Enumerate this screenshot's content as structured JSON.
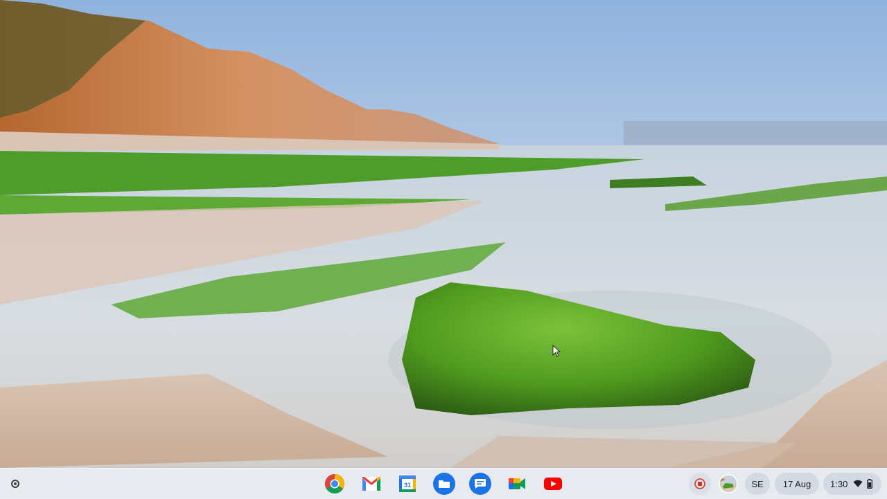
{
  "desktop": {
    "wallpaper": "coastal-cliff-beach-mossy-rock"
  },
  "shelf": {
    "launcher_icon": "launcher-circle-icon",
    "pinned_apps": [
      {
        "name": "Chrome",
        "icon": "chrome-icon"
      },
      {
        "name": "Gmail",
        "icon": "gmail-icon"
      },
      {
        "name": "Google Calendar",
        "icon": "calendar-icon",
        "badge": "31"
      },
      {
        "name": "Files",
        "icon": "files-folder-icon"
      },
      {
        "name": "Messages",
        "icon": "messages-icon"
      },
      {
        "name": "Google Meet",
        "icon": "meet-icon"
      },
      {
        "name": "YouTube",
        "icon": "youtube-icon"
      }
    ],
    "tray": {
      "screen_record_icon": "stop-recording-icon",
      "holding_space_icon": "holding-space-thumbnail",
      "ime": "SE",
      "date": "17 Aug",
      "time": "1:30",
      "wifi_icon": "wifi-icon",
      "battery_icon": "battery-icon"
    }
  },
  "colors": {
    "recording_red": "#d93025",
    "chrome_red": "#db4437",
    "chrome_yellow": "#f4b400",
    "chrome_green": "#0f9d58",
    "chrome_blue": "#4285f4",
    "files_blue": "#1a73e8",
    "youtube_red": "#ff0000"
  }
}
